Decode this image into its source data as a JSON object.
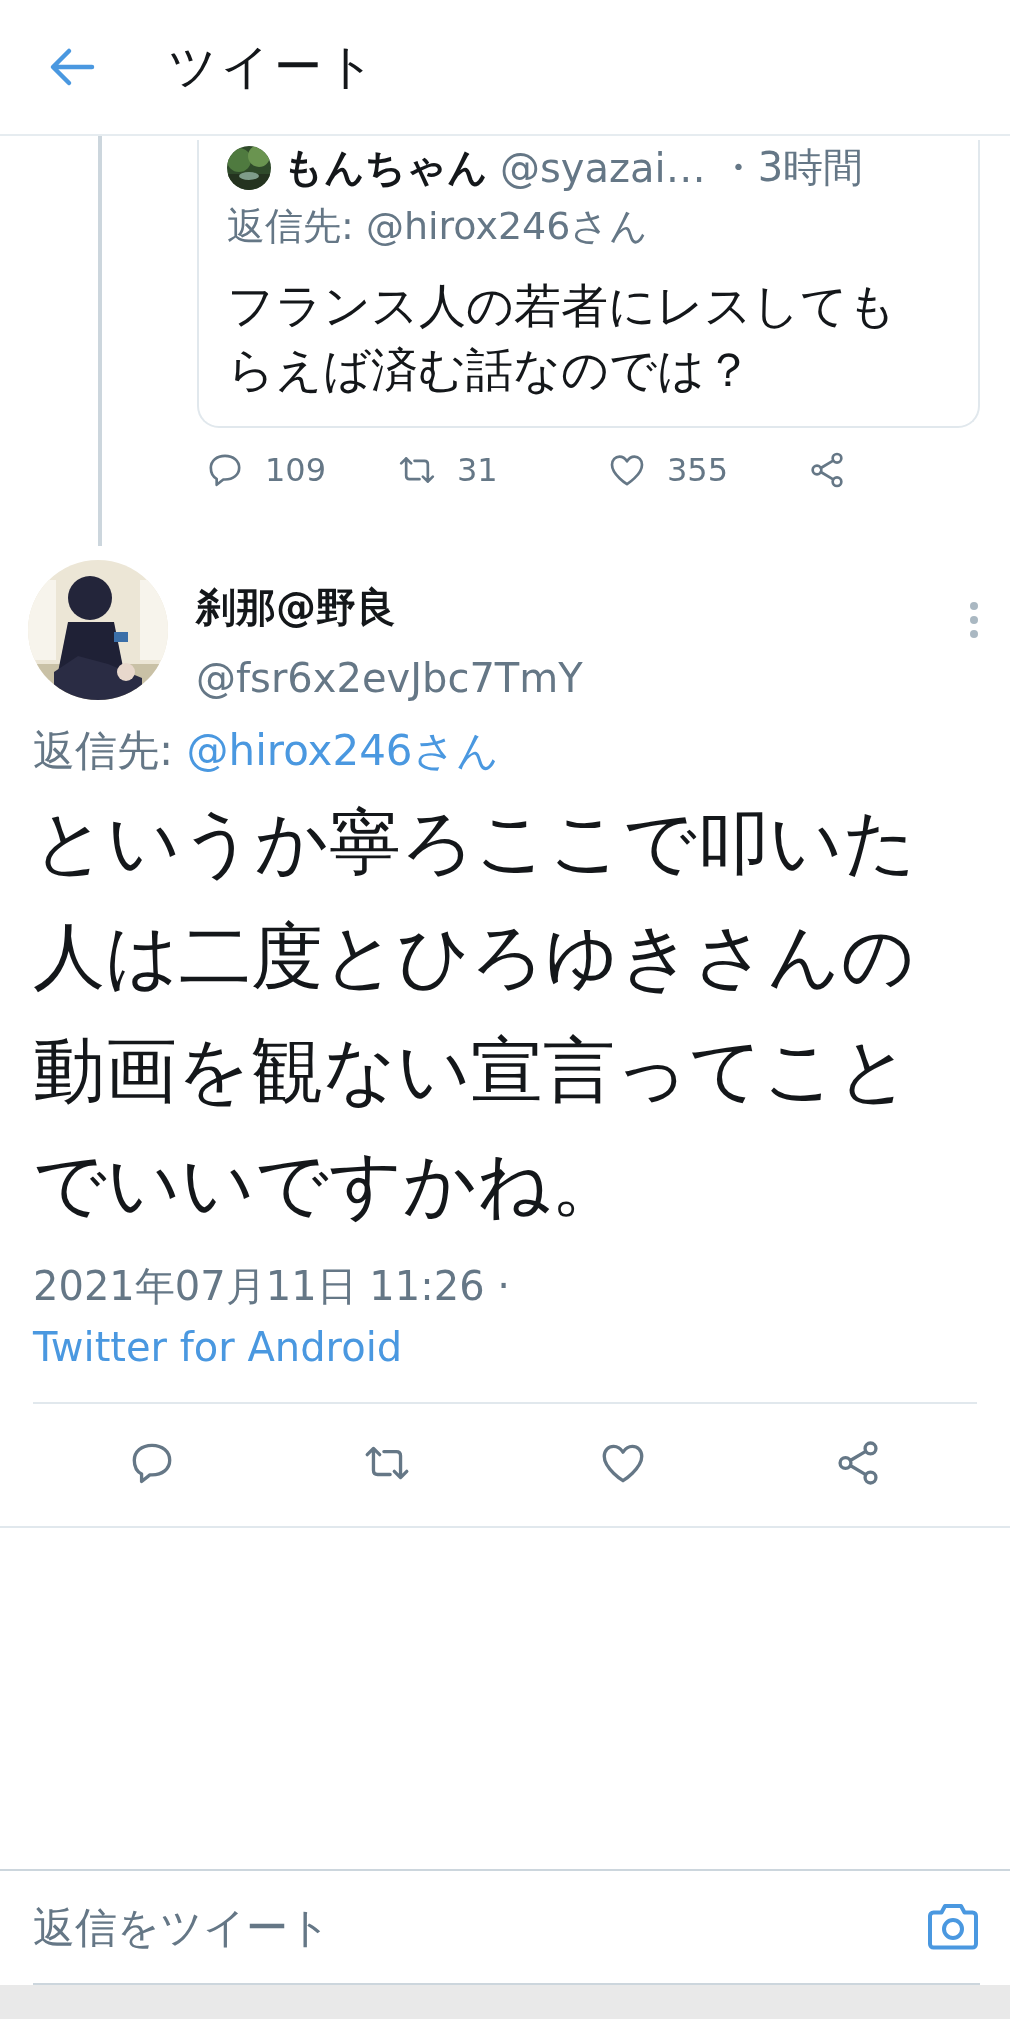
{
  "header": {
    "title": "ツイート"
  },
  "quoted_tweet": {
    "author": "もんちゃん",
    "handle": "@syazai…",
    "time": "・3時間",
    "reply_label": "返信先:",
    "reply_to": "@hirox246さん",
    "text": "フランス人の若者にレスしてもらえば済む話なのでは？"
  },
  "quoted_actions": [
    {
      "kind": "reply",
      "count": "109"
    },
    {
      "kind": "retweet",
      "count": "31"
    },
    {
      "kind": "like",
      "count": "355"
    },
    {
      "kind": "share"
    }
  ],
  "tweet": {
    "author": "刹那@野良",
    "handle": "@fsr6x2evJbc7TmY",
    "reply_label": "返信先:",
    "reply_to": "@hirox246さん",
    "text": "というか寧ろここで叩いた人は二度とひろゆきさんの動画を観ない宣言ってことでいいですかね。",
    "timestamp": "2021年07月11日 11:26 ·",
    "source": "Twitter for Android"
  },
  "tweet_actions": [
    {
      "kind": "reply"
    },
    {
      "kind": "retweet"
    },
    {
      "kind": "like"
    },
    {
      "kind": "share"
    }
  ],
  "reply_field": {
    "placeholder": "返信をツイート"
  }
}
